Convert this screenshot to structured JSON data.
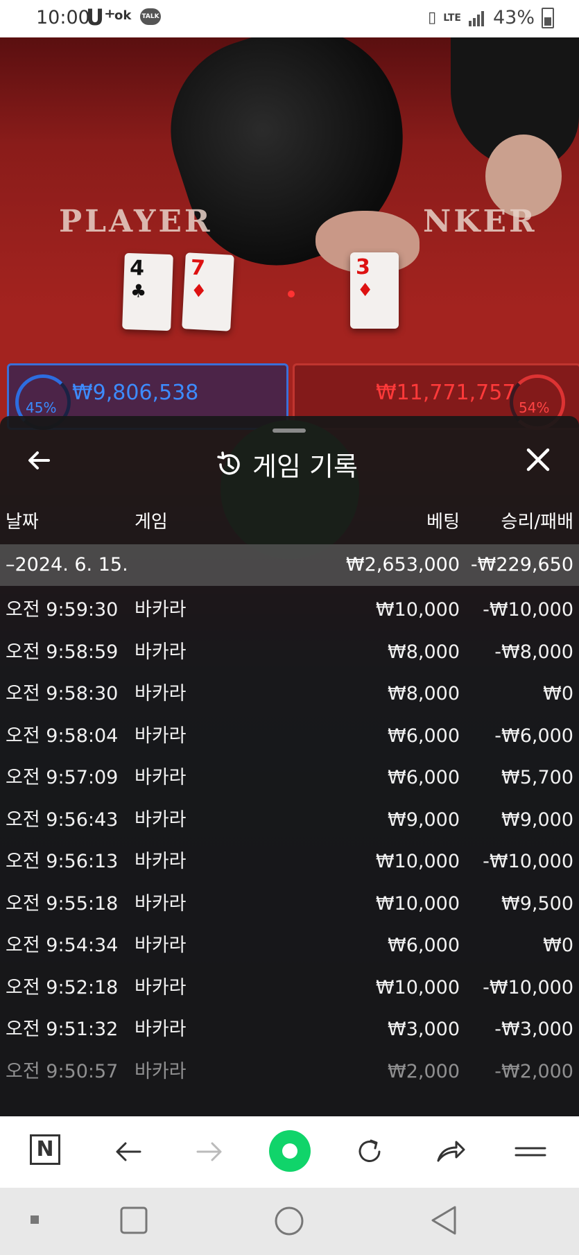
{
  "status_bar": {
    "time": "10:00",
    "carrier": "U⁺",
    "ok_badge": "ok",
    "talk_badge": "TALK",
    "network": "LTE",
    "battery": "43%"
  },
  "game_view": {
    "player_label": "PLAYER",
    "banker_label": "NKER",
    "player_cards": [
      {
        "rank": "4",
        "suit": "♣",
        "color": "#111111"
      },
      {
        "rank": "7",
        "suit": "♦",
        "color": "#dd1111"
      }
    ],
    "banker_cards": [
      {
        "rank": "3",
        "suit": "♦",
        "color": "#dd1111"
      }
    ],
    "player_percent": "45%",
    "banker_percent": "54%",
    "player_amount": "₩9,806,538",
    "banker_amount": "₩11,771,757"
  },
  "sheet": {
    "title": "게임 기록",
    "columns": {
      "date": "날짜",
      "game": "게임",
      "bet": "베팅",
      "win_loss": "승리/패배"
    },
    "summary": {
      "date": "–2024. 6. 15.",
      "bet": "₩2,653,000",
      "win_loss": "-₩229,650"
    },
    "rows": [
      {
        "time": "오전 9:59:30",
        "game": "바카라",
        "bet": "₩10,000",
        "win_loss": "-₩10,000"
      },
      {
        "time": "오전 9:58:59",
        "game": "바카라",
        "bet": "₩8,000",
        "win_loss": "-₩8,000"
      },
      {
        "time": "오전 9:58:30",
        "game": "바카라",
        "bet": "₩8,000",
        "win_loss": "₩0"
      },
      {
        "time": "오전 9:58:04",
        "game": "바카라",
        "bet": "₩6,000",
        "win_loss": "-₩6,000"
      },
      {
        "time": "오전 9:57:09",
        "game": "바카라",
        "bet": "₩6,000",
        "win_loss": "₩5,700"
      },
      {
        "time": "오전 9:56:43",
        "game": "바카라",
        "bet": "₩9,000",
        "win_loss": "₩9,000"
      },
      {
        "time": "오전 9:56:13",
        "game": "바카라",
        "bet": "₩10,000",
        "win_loss": "-₩10,000"
      },
      {
        "time": "오전 9:55:18",
        "game": "바카라",
        "bet": "₩10,000",
        "win_loss": "₩9,500"
      },
      {
        "time": "오전 9:54:34",
        "game": "바카라",
        "bet": "₩6,000",
        "win_loss": "₩0"
      },
      {
        "time": "오전 9:52:18",
        "game": "바카라",
        "bet": "₩10,000",
        "win_loss": "-₩10,000"
      },
      {
        "time": "오전 9:51:32",
        "game": "바카라",
        "bet": "₩3,000",
        "win_loss": "-₩3,000"
      },
      {
        "time": "오전 9:50:57",
        "game": "바카라",
        "bet": "₩2,000",
        "win_loss": "-₩2,000"
      }
    ]
  },
  "browser_bar": {
    "icons": [
      "naver-n-icon",
      "back-arrow-icon",
      "forward-arrow-icon",
      "green-home-icon",
      "refresh-icon",
      "share-icon",
      "menu-icon"
    ]
  },
  "colors": {
    "player_blue": "#3d8cff",
    "banker_red": "#ff3a3a",
    "green_button": "#10d46a"
  }
}
